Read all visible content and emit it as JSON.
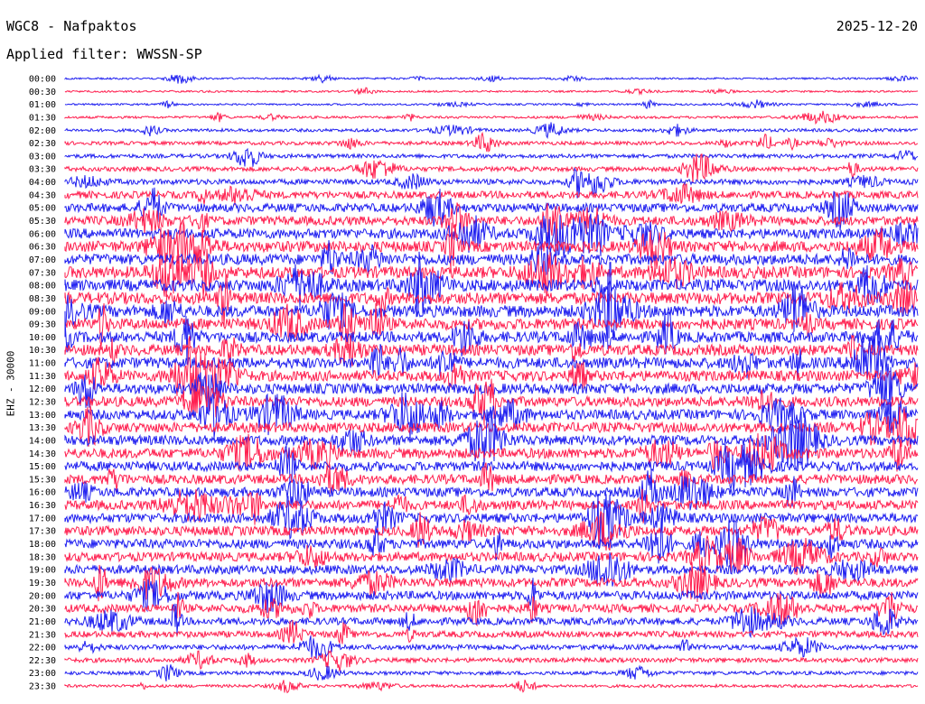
{
  "header": {
    "station": "WGC8 - Nafpaktos",
    "date": "2025-12-20",
    "filter": "Applied filter: WWSSN-SP",
    "channel": "EHZ - 30000"
  },
  "colors": {
    "trace_a": "#1f1ff0",
    "trace_b": "#ff1f4f",
    "background": "#ffffff",
    "text": "#000000"
  },
  "chart_data": {
    "type": "line",
    "title": "WGC8 - Nafpaktos",
    "ylabel": "EHZ - 30000",
    "xlabel": "",
    "grid": false,
    "trace_colors": [
      "#1f1ff0",
      "#ff1f4f"
    ],
    "rows": [
      "00:00",
      "00:30",
      "01:00",
      "01:30",
      "02:00",
      "02:30",
      "03:00",
      "03:30",
      "04:00",
      "04:30",
      "05:00",
      "05:30",
      "06:00",
      "06:30",
      "07:00",
      "07:30",
      "08:00",
      "08:30",
      "09:00",
      "09:30",
      "10:00",
      "10:30",
      "11:00",
      "11:30",
      "12:00",
      "12:30",
      "13:00",
      "13:30",
      "14:00",
      "14:30",
      "15:00",
      "15:30",
      "16:00",
      "16:30",
      "17:00",
      "17:30",
      "18:00",
      "18:30",
      "19:00",
      "19:30",
      "20:00",
      "20:30",
      "21:00",
      "21:30",
      "22:00",
      "22:30",
      "23:00",
      "23:30"
    ],
    "row_amplitude": [
      1,
      1,
      1,
      1.3,
      1.7,
      2,
      2.2,
      2.5,
      3,
      4,
      4.8,
      5,
      5.5,
      6,
      6,
      6.5,
      6.5,
      6.5,
      6.5,
      6.2,
      6,
      6,
      6,
      5.8,
      5.8,
      5.5,
      5.5,
      5.5,
      5.5,
      5.5,
      5.2,
      5.2,
      5.2,
      5.2,
      5.2,
      5.2,
      5.2,
      5,
      5,
      5,
      4.8,
      4.5,
      4,
      3.5,
      2.8,
      2.5,
      2,
      1.6
    ]
  }
}
